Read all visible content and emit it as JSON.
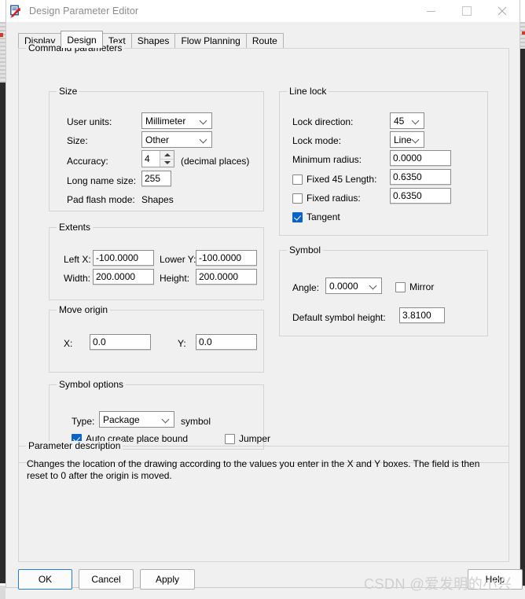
{
  "window": {
    "title": "Design Parameter Editor",
    "icon": "design-parameter-editor-icon",
    "controls": {
      "minimize": "minimize",
      "maximize": "maximize",
      "close": "close"
    }
  },
  "tabs": [
    {
      "label": "Display",
      "selected": false
    },
    {
      "label": "Design",
      "selected": true
    },
    {
      "label": "Text",
      "selected": false
    },
    {
      "label": "Shapes",
      "selected": false
    },
    {
      "label": "Flow Planning",
      "selected": false
    },
    {
      "label": "Route",
      "selected": false
    }
  ],
  "command_parameters": {
    "legend": "Command parameters",
    "size": {
      "legend": "Size",
      "user_units_label": "User units:",
      "user_units_value": "Millimeter",
      "size_label": "Size:",
      "size_value": "Other",
      "accuracy_label": "Accuracy:",
      "accuracy_value": "4",
      "accuracy_suffix": "(decimal places)",
      "long_name_size_label": "Long name size:",
      "long_name_size_value": "255",
      "pad_flash_mode_label": "Pad flash mode:",
      "pad_flash_mode_value": "Shapes"
    },
    "line_lock": {
      "legend": "Line lock",
      "lock_direction_label": "Lock direction:",
      "lock_direction_value": "45",
      "lock_mode_label": "Lock mode:",
      "lock_mode_value": "Line",
      "minimum_radius_label": "Minimum radius:",
      "minimum_radius_value": "0.0000",
      "fixed_45_length_label": "Fixed 45 Length:",
      "fixed_45_length_checked": false,
      "fixed_45_length_value": "0.6350",
      "fixed_radius_label": "Fixed radius:",
      "fixed_radius_checked": false,
      "fixed_radius_value": "0.6350",
      "tangent_label": "Tangent",
      "tangent_checked": true
    },
    "extents": {
      "legend": "Extents",
      "left_x_label": "Left X:",
      "left_x_value": "-100.0000",
      "lower_y_label": "Lower Y:",
      "lower_y_value": "-100.0000",
      "width_label": "Width:",
      "width_value": "200.0000",
      "height_label": "Height:",
      "height_value": "200.0000"
    },
    "move_origin": {
      "legend": "Move origin",
      "x_label": "X:",
      "x_value": "0.0",
      "y_label": "Y:",
      "y_value": "0.0"
    },
    "symbol": {
      "legend": "Symbol",
      "angle_label": "Angle:",
      "angle_value": "0.0000",
      "mirror_label": "Mirror",
      "mirror_checked": false,
      "default_symbol_height_label": "Default symbol height:",
      "default_symbol_height_value": "3.8100"
    },
    "symbol_options": {
      "legend": "Symbol options",
      "type_label": "Type:",
      "type_value": "Package",
      "type_suffix": "symbol",
      "auto_create_place_bound_label": "Auto create place bound",
      "auto_create_place_bound_checked": true,
      "jumper_label": "Jumper",
      "jumper_checked": false
    }
  },
  "parameter_description": {
    "legend": "Parameter description",
    "text": "Changes the location of the drawing according to the values you enter in the X and Y boxes. The field is then reset to 0 after the origin is moved."
  },
  "footer": {
    "ok": "OK",
    "cancel": "Cancel",
    "apply": "Apply",
    "help": "Help"
  },
  "watermark": "CSDN @爱发明的小兴",
  "colors": {
    "accent": "#0a64c8",
    "default_button_border": "#1f7fd4",
    "window_background": "#f0f0f0",
    "title_text": "#8a8a8a"
  }
}
